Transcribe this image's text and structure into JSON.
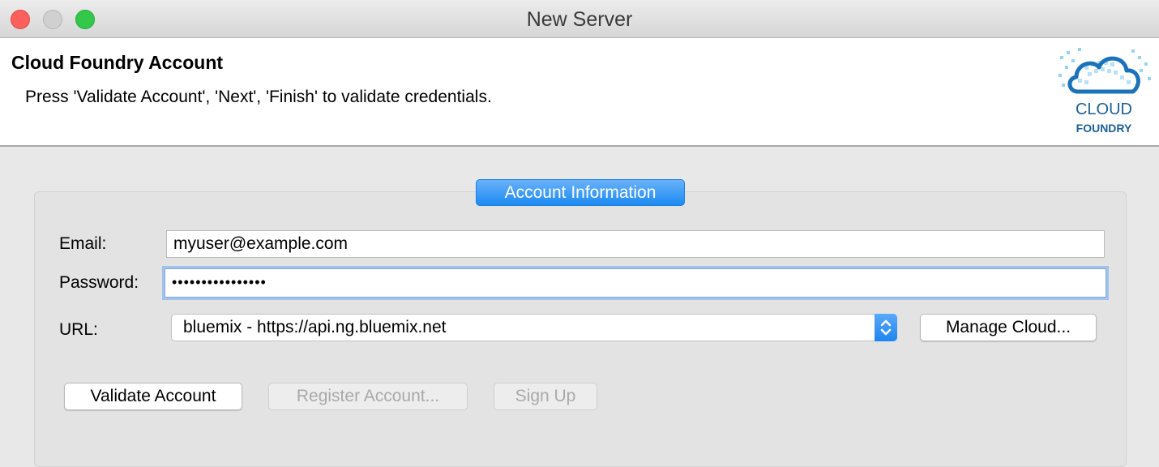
{
  "window": {
    "title": "New Server"
  },
  "header": {
    "title": "Cloud Foundry Account",
    "description": "Press 'Validate Account', 'Next', 'Finish' to validate credentials.",
    "logo_text_line1": "CLOUD",
    "logo_text_line2": "FOUNDRY"
  },
  "account": {
    "group_label": "Account Information",
    "email_label": "Email:",
    "email_value": "myuser@example.com",
    "password_label": "Password:",
    "password_value": "••••••••••••••••",
    "url_label": "URL:",
    "url_selected": "bluemix - https://api.ng.bluemix.net",
    "manage_cloud_label": "Manage Cloud..."
  },
  "actions": {
    "validate_label": "Validate Account",
    "register_label": "Register Account...",
    "signup_label": "Sign Up"
  },
  "colors": {
    "accent": "#1d8bf2",
    "close": "#fc605c",
    "maximize": "#34c84a"
  },
  "icons": {
    "logo": "cloud-foundry-logo-icon",
    "select_arrows": "up-down-chevron-icon"
  }
}
